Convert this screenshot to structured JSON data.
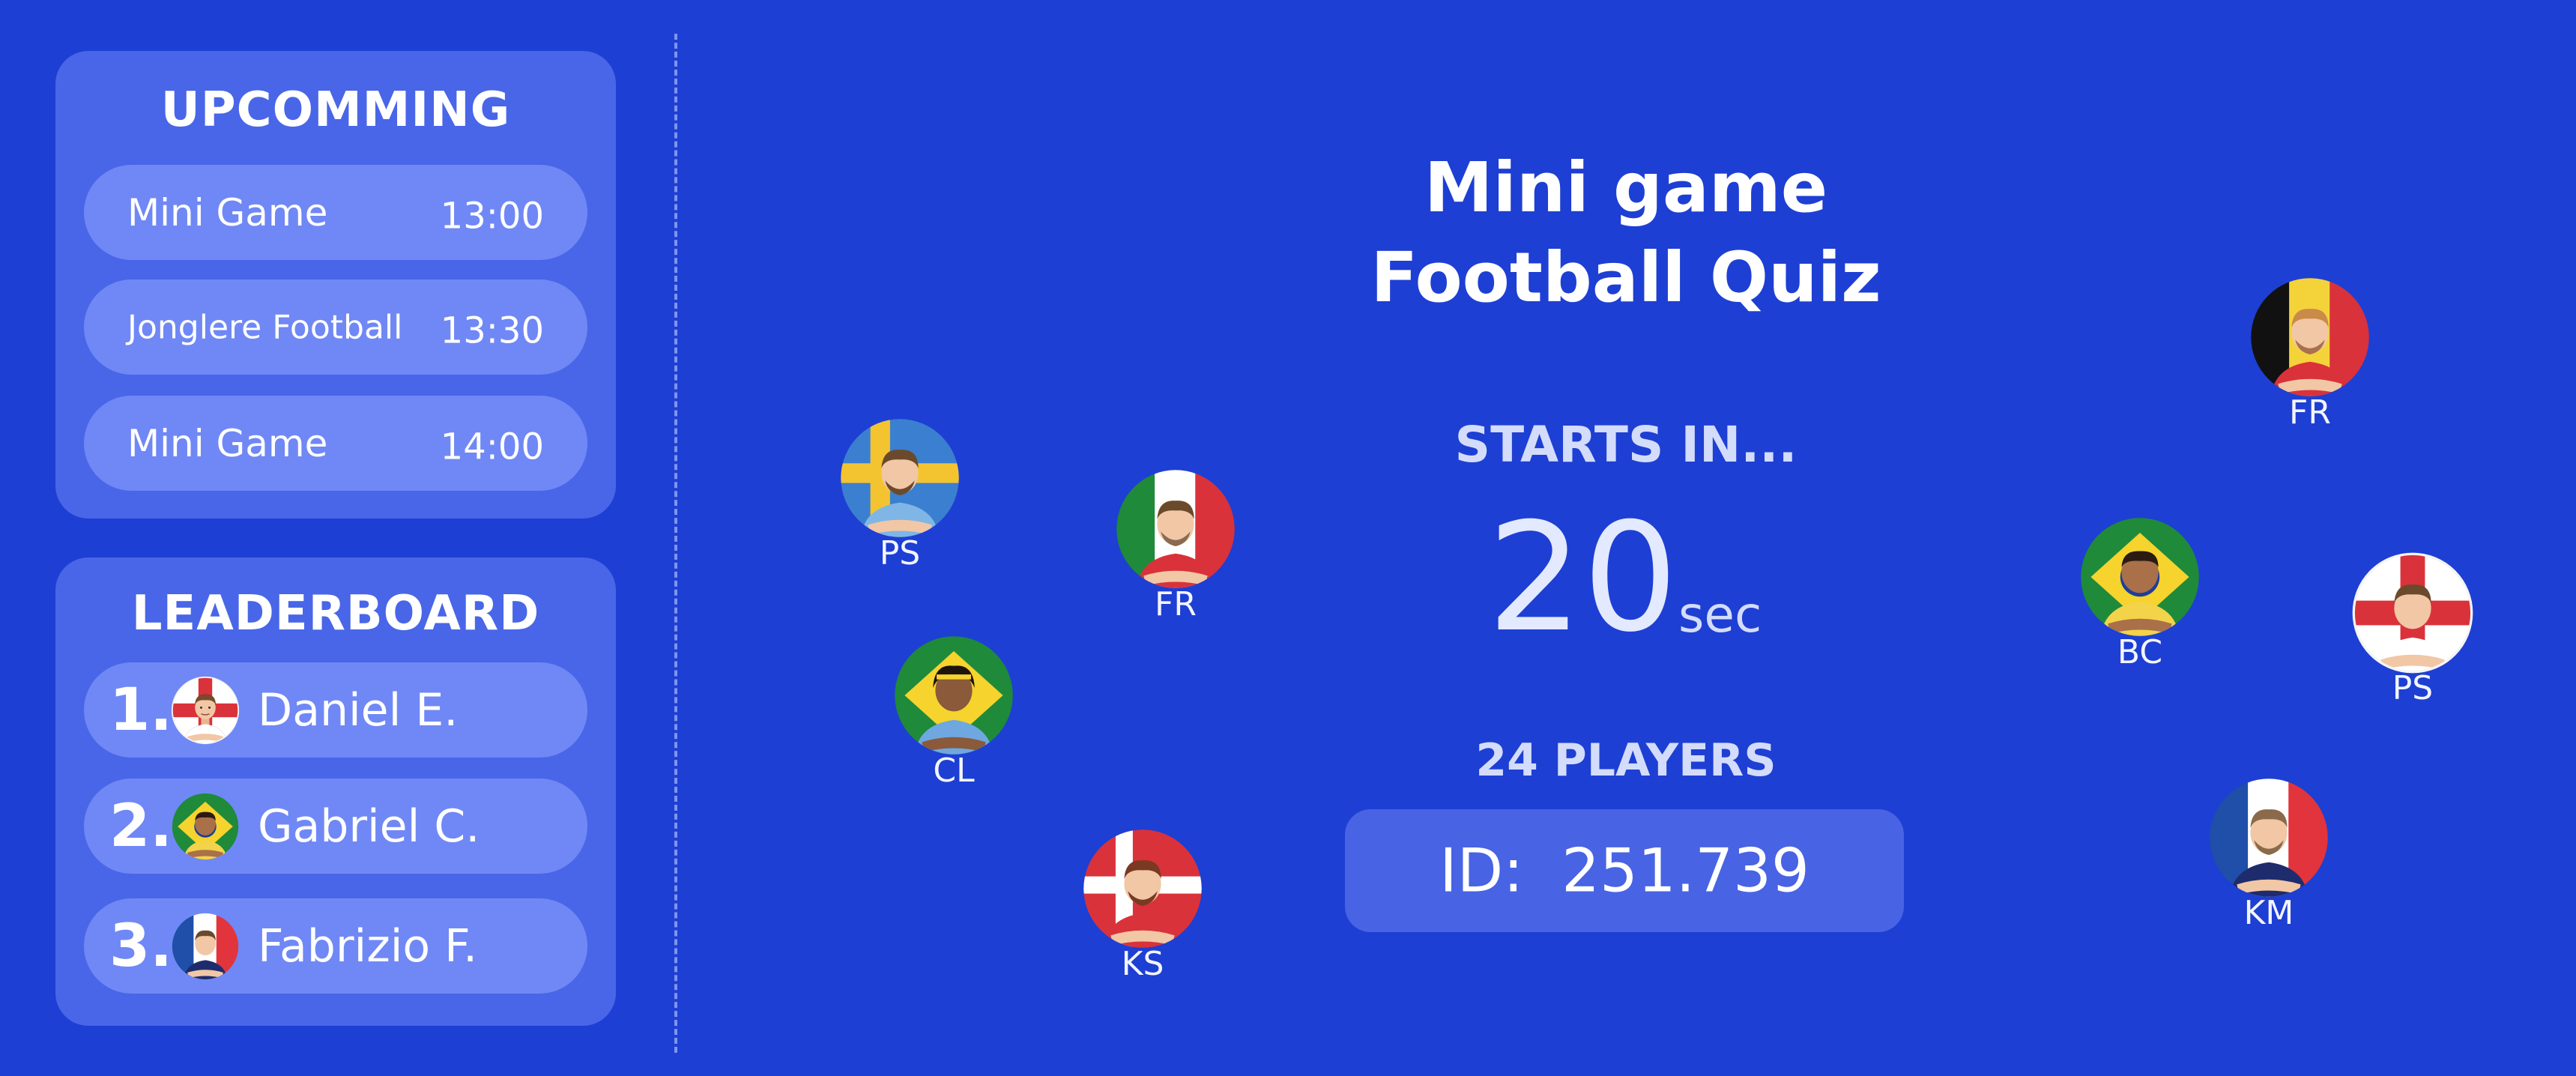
{
  "upcoming": {
    "title": "UPCOMMING",
    "items": [
      {
        "name": "Mini Game",
        "time": "13:00"
      },
      {
        "name": "Jonglere Football",
        "time": "13:30"
      },
      {
        "name": "Mini Game",
        "time": "14:00"
      }
    ]
  },
  "leaderboard": {
    "title": "LEADERBOARD",
    "entries": [
      {
        "rank": "1.",
        "name": "Daniel E.",
        "avatar_icon": "player-avatar-england-icon"
      },
      {
        "rank": "2.",
        "name": "Gabriel C.",
        "avatar_icon": "player-avatar-brazil-icon"
      },
      {
        "rank": "3.",
        "name": "Fabrizio F.",
        "avatar_icon": "player-avatar-france-icon"
      }
    ]
  },
  "game": {
    "title_line1": "Mini game",
    "title_line2": "Football Quiz",
    "starts_label": "STARTS IN...",
    "countdown_value": "20",
    "countdown_unit": "sec",
    "players_label": "24 PLAYERS",
    "id_label": "ID:",
    "id_value": "251.739"
  },
  "players": [
    {
      "initials": "PS",
      "flag": "sweden"
    },
    {
      "initials": "FR",
      "flag": "italy"
    },
    {
      "initials": "CL",
      "flag": "brazil"
    },
    {
      "initials": "KS",
      "flag": "denmark"
    },
    {
      "initials": "FR",
      "flag": "belgium"
    },
    {
      "initials": "BC",
      "flag": "brazil"
    },
    {
      "initials": "PS",
      "flag": "england"
    },
    {
      "initials": "KM",
      "flag": "france"
    }
  ],
  "colors": {
    "background": "#1e3fd3",
    "panel": "#4966e8",
    "pill": "#7088f5",
    "id_box": "#4863e4"
  }
}
